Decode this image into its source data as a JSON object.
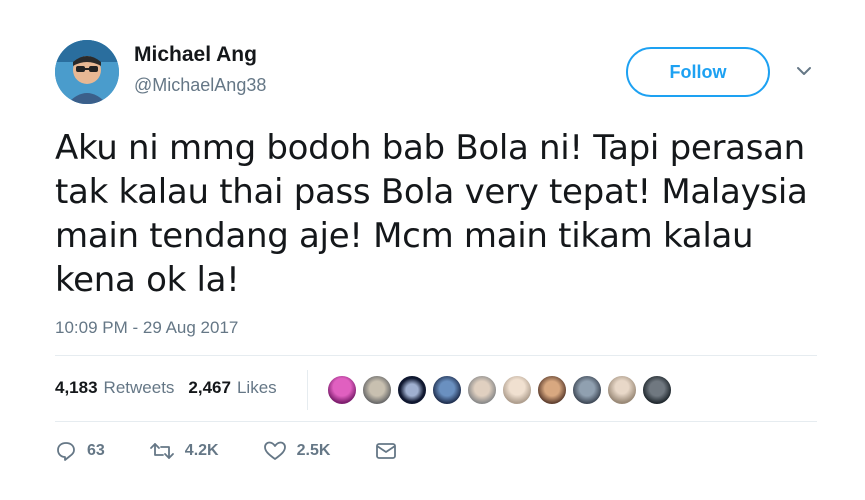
{
  "author": {
    "name": "Michael Ang",
    "handle": "@MichaelAng38"
  },
  "follow_label": "Follow",
  "tweet_text": "Aku ni mmg bodoh bab Bola ni! Tapi perasan tak kalau thai pass Bola very tepat! Malaysia main tendang aje! Mcm main tikam kalau kena ok la!",
  "timestamp": "10:09 PM - 29 Aug 2017",
  "stats": {
    "retweets_count": "4,183",
    "retweets_label": "Retweets",
    "likes_count": "2,467",
    "likes_label": "Likes"
  },
  "actions": {
    "reply_count": "63",
    "retweet_count": "4.2K",
    "like_count": "2.5K"
  },
  "colors": {
    "accent": "#1da1f2",
    "muted": "#657786",
    "text": "#14171a"
  },
  "icons": [
    "chevron-down-icon",
    "reply-icon",
    "retweet-icon",
    "heart-icon",
    "message-icon"
  ]
}
